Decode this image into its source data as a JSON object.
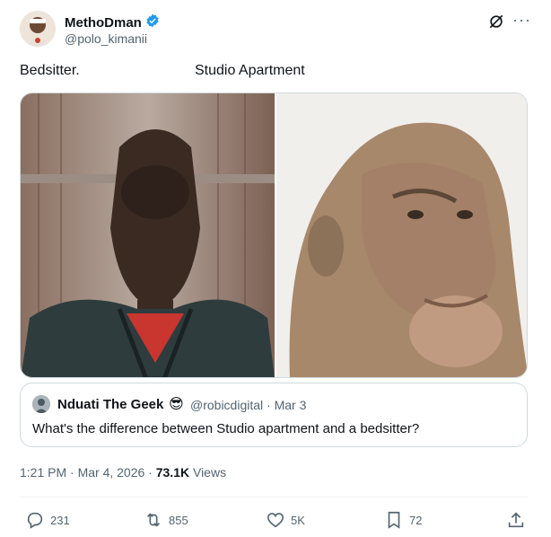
{
  "author": {
    "name": "MethoDman",
    "handle": "@polo_kimanii",
    "verified": true
  },
  "captions": {
    "left": "Bedsitter.",
    "right": "Studio Apartment"
  },
  "quote": {
    "name": "Nduati The Geek",
    "emoji": "😎",
    "meta": "@robicdigital · Mar 3",
    "text": "What's the difference between Studio apartment and a bedsitter?"
  },
  "post_meta": {
    "time": "1:21 PM · Mar 4, 2026 · ",
    "views_count": "73.1K",
    "views_label": " Views"
  },
  "actions": {
    "replies": "231",
    "reposts": "855",
    "likes": "5K",
    "bookmarks": "72"
  },
  "colors": {
    "verified": "#1d9bf0",
    "muted": "#536471",
    "border": "#cfd9de"
  }
}
